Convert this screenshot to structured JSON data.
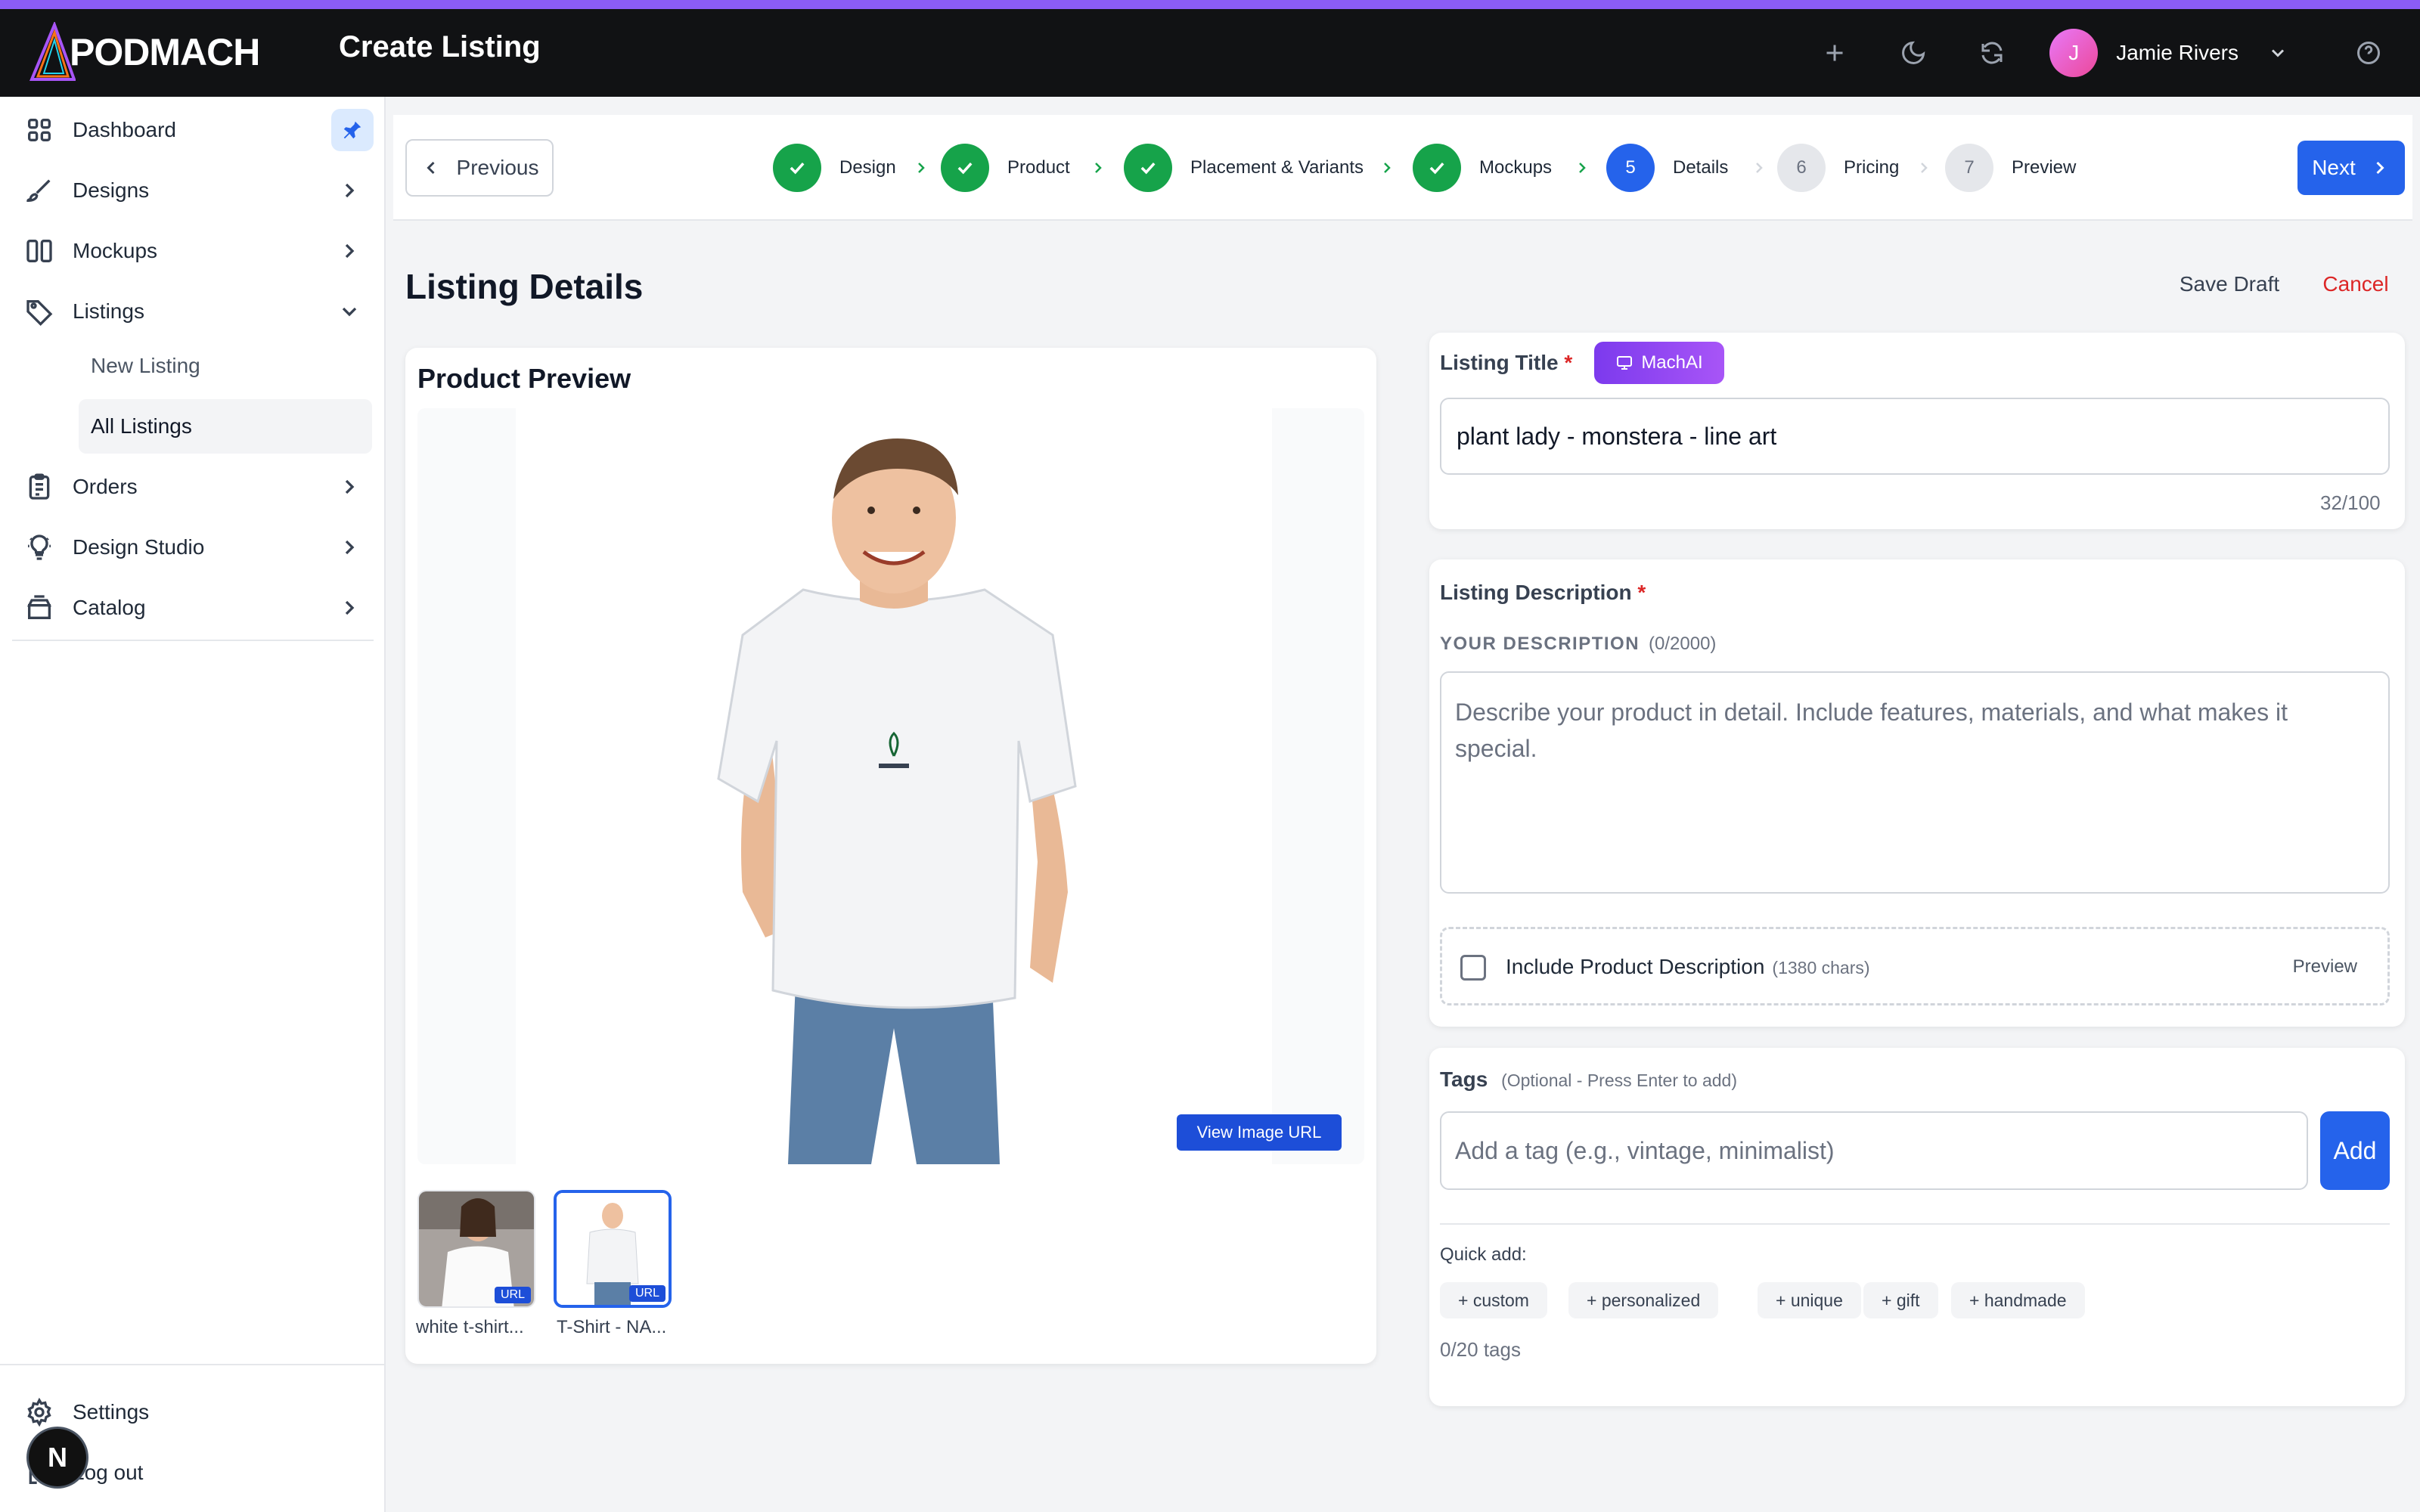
{
  "header": {
    "logo_text": "PODMACH",
    "page_title": "Create Listing",
    "user": {
      "initial": "J",
      "name": "Jamie Rivers"
    }
  },
  "sidebar": {
    "items": [
      {
        "label": "Dashboard"
      },
      {
        "label": "Designs"
      },
      {
        "label": "Mockups"
      },
      {
        "label": "Listings"
      },
      {
        "label": "Orders"
      },
      {
        "label": "Design Studio"
      },
      {
        "label": "Catalog"
      }
    ],
    "listings_sub": [
      {
        "label": "New Listing"
      },
      {
        "label": "All Listings"
      }
    ],
    "settings_label": "Settings",
    "logout_label": "Log out",
    "badge_letter": "N"
  },
  "stepper": {
    "previous_label": "Previous",
    "next_label": "Next",
    "steps": [
      {
        "label": "Design",
        "status": "done"
      },
      {
        "label": "Product",
        "status": "done"
      },
      {
        "label": "Placement & Variants",
        "status": "done"
      },
      {
        "label": "Mockups",
        "status": "done"
      },
      {
        "number": "5",
        "label": "Details",
        "status": "current"
      },
      {
        "number": "6",
        "label": "Pricing",
        "status": "upcoming"
      },
      {
        "number": "7",
        "label": "Preview",
        "status": "upcoming"
      }
    ]
  },
  "main": {
    "heading": "Listing Details",
    "save_draft_label": "Save Draft",
    "cancel_label": "Cancel"
  },
  "preview": {
    "title": "Product Preview",
    "view_url_label": "View Image URL",
    "thumbnails": [
      {
        "label": "white t-shirt...",
        "tag": "URL"
      },
      {
        "label": "T-Shirt - NA...",
        "tag": "URL"
      }
    ]
  },
  "listing_title": {
    "label": "Listing Title",
    "required_mark": "*",
    "ai_button": "MachAI",
    "value": "plant lady - monstera - line art",
    "counter": "32/100"
  },
  "description": {
    "label": "Listing Description",
    "required_mark": "*",
    "section_label": "YOUR DESCRIPTION",
    "section_count": "(0/2000)",
    "placeholder": "Describe your product in detail. Include features, materials, and what makes it special.",
    "include_label": "Include Product Description",
    "include_chars": "(1380 chars)",
    "include_preview": "Preview"
  },
  "tags": {
    "label": "Tags",
    "hint": "(Optional - Press Enter to add)",
    "placeholder": "Add a tag (e.g., vintage, minimalist)",
    "add_label": "Add",
    "quick_add_label": "Quick add:",
    "quick": [
      "+ custom",
      "+ personalized",
      "+ unique",
      "+ gift",
      "+ handmade"
    ],
    "count": "0/20 tags"
  },
  "colors": {
    "accent": "#2563eb",
    "success": "#16a34a",
    "danger": "#dc2626",
    "topbar": "#111214",
    "stripe": "#8b5cf6"
  }
}
